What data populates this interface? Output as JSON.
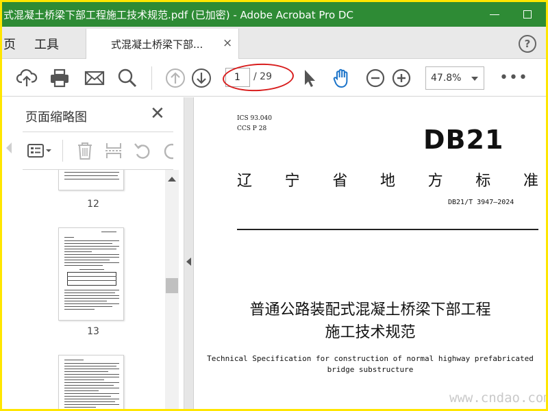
{
  "window": {
    "title": "式混凝土桥梁下部工程施工技术规范.pdf (已加密) - Adobe Acrobat Pro DC"
  },
  "tabbar": {
    "home_label": "页",
    "tools_label": "工具",
    "doc_tab_label": "式混凝土桥梁下部...",
    "close_glyph": "×",
    "help_glyph": "?"
  },
  "toolbar": {
    "current_page": "1",
    "total_pages": "/ 29",
    "zoom": "47.8%",
    "more_glyph": "•••"
  },
  "thumbnails_panel": {
    "title": "页面缩略图",
    "close_glyph": "✕",
    "pages": [
      "12",
      "13"
    ]
  },
  "document": {
    "ics": "ICS 93.040",
    "ccs": "CCS P 28",
    "code_logo": "DB21",
    "standard_type_chars": [
      "辽",
      "宁",
      "省",
      "地",
      "方",
      "标",
      "准"
    ],
    "standard_number": "DB21/T 3947—2024",
    "title_line1": "普通公路装配式混凝土桥梁下部工程",
    "title_line2": "施工技术规范",
    "english_line1": "Technical Specification for construction of normal highway prefabricated",
    "english_line2": "bridge substructure"
  },
  "watermark": "www.cndao.com",
  "colors": {
    "titlebar": "#2e8b35",
    "frame_border": "#ffe600",
    "annotation_red": "#d81c1c",
    "hand_tool_blue": "#1a73c9"
  }
}
